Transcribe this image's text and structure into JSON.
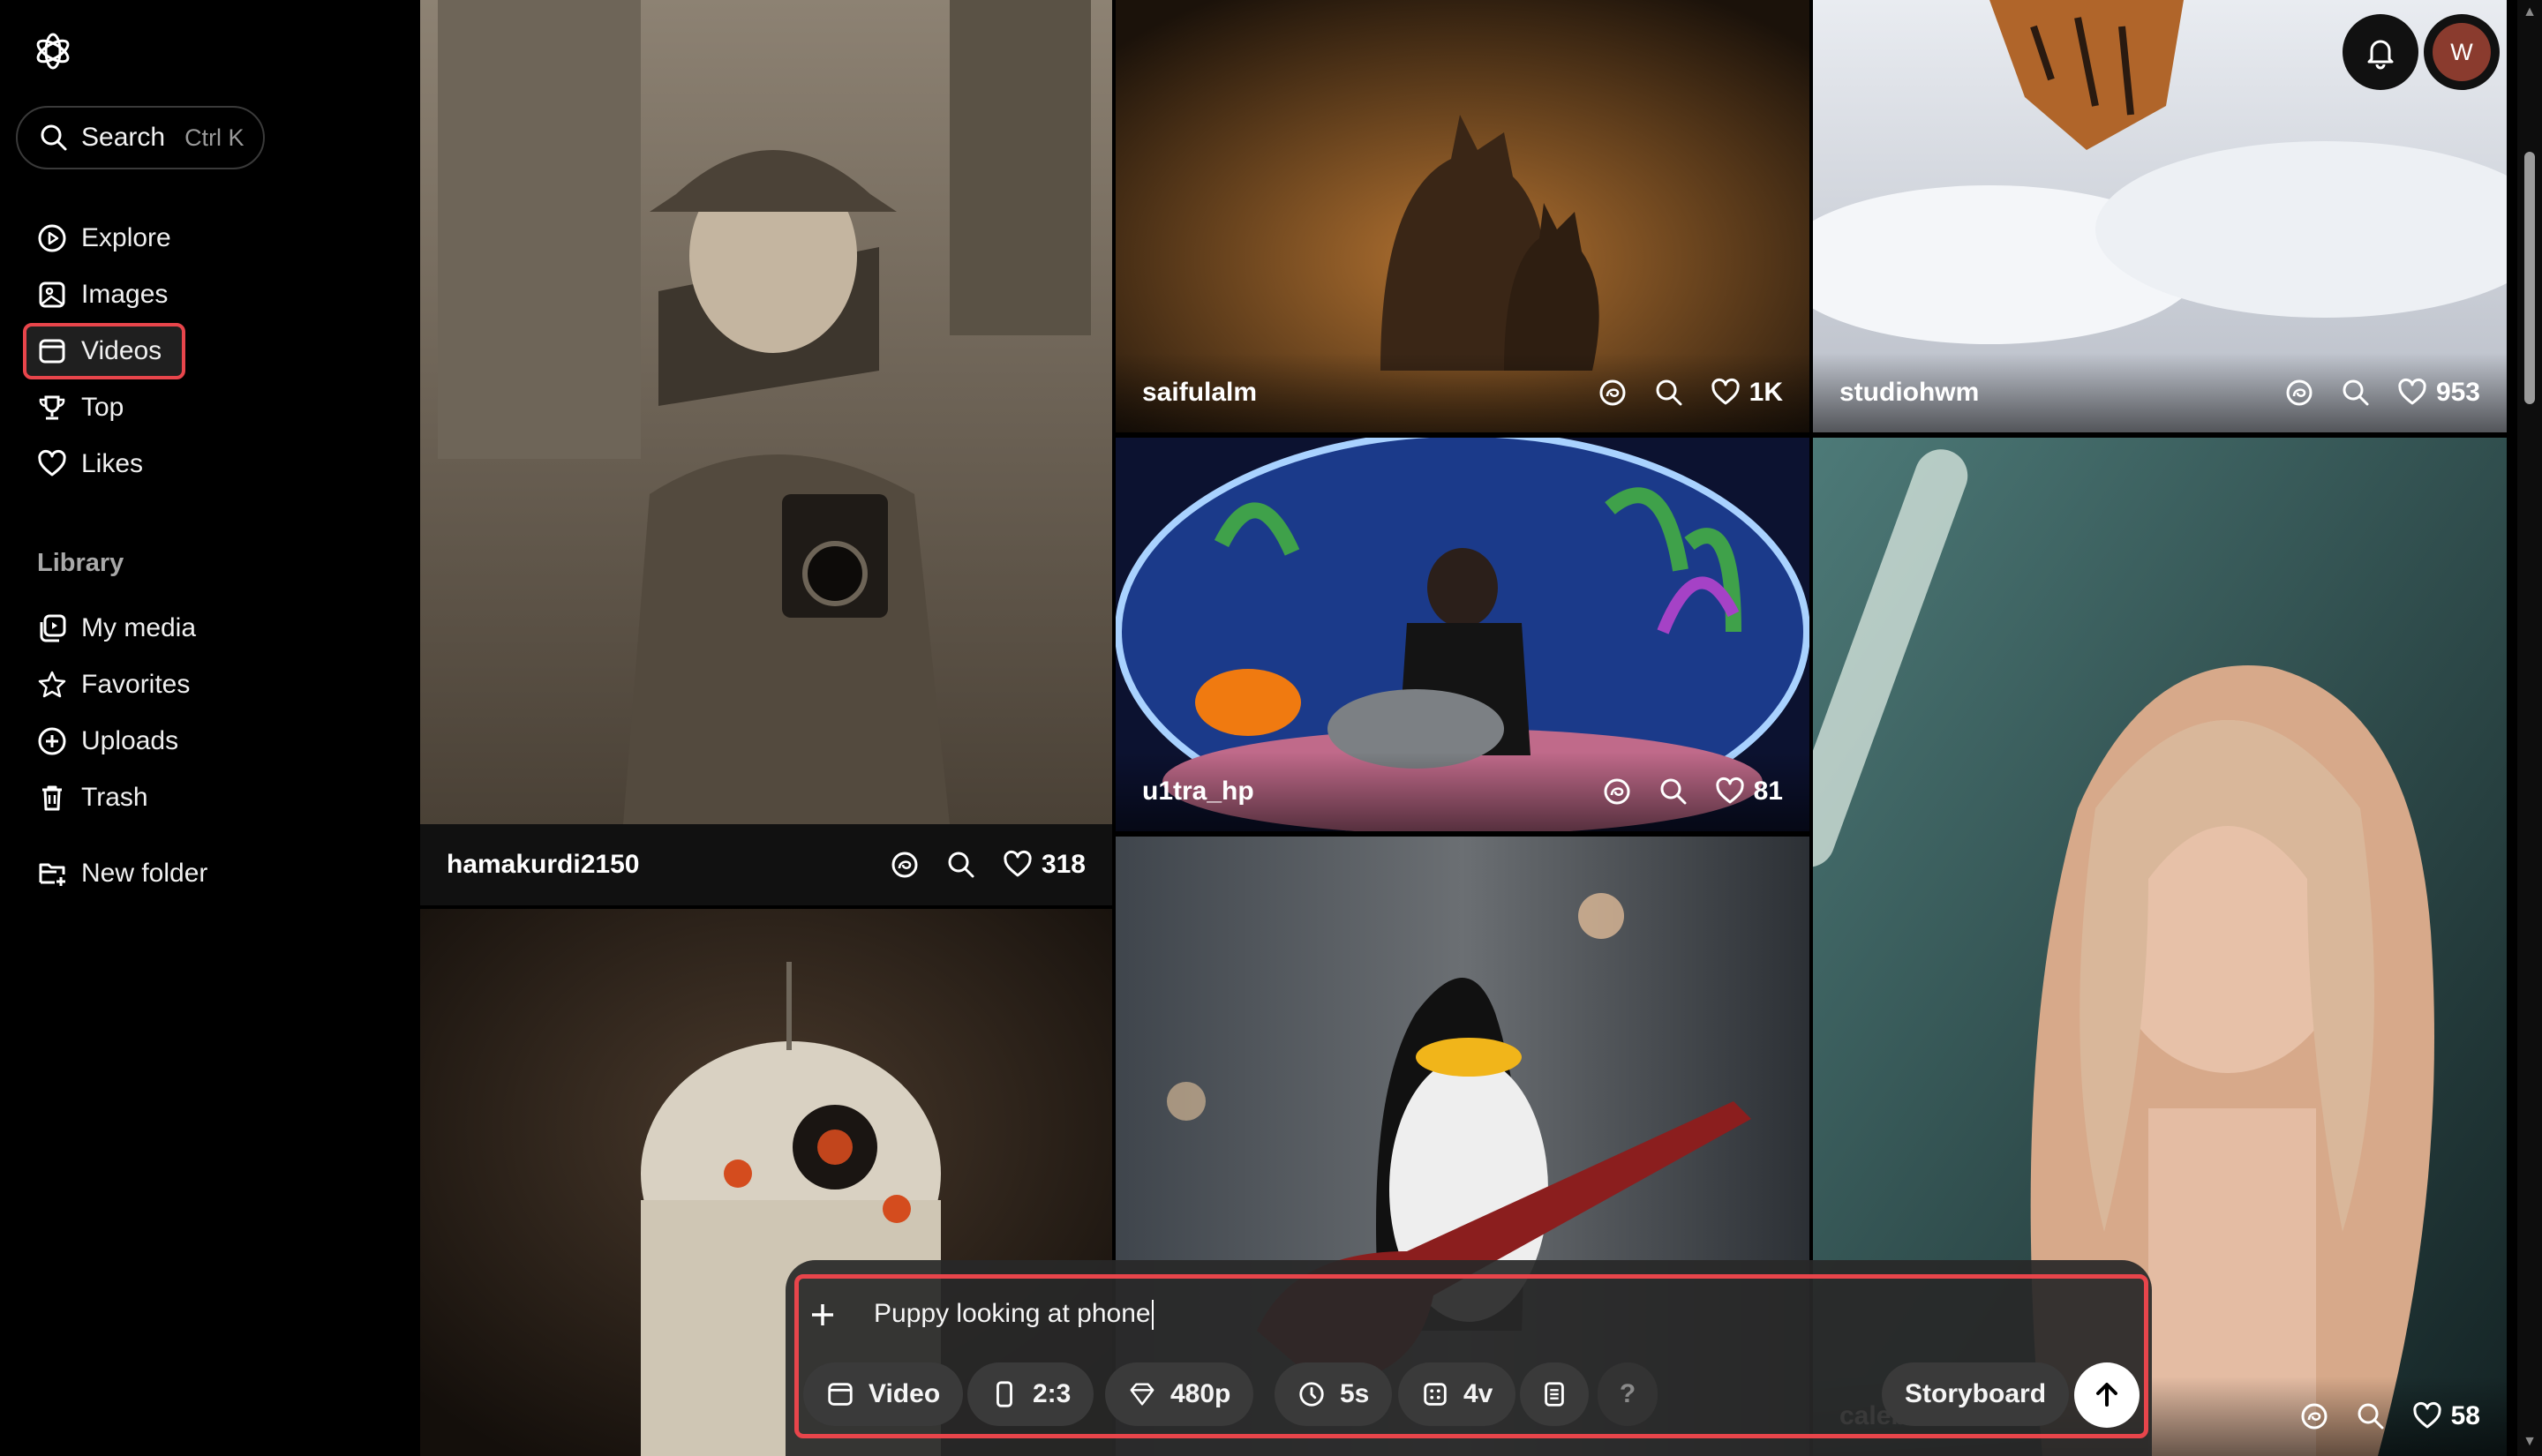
{
  "sidebar": {
    "search": {
      "label": "Search",
      "shortcut": "Ctrl K"
    },
    "nav": [
      {
        "label": "Explore",
        "icon": "play-circle-icon"
      },
      {
        "label": "Images",
        "icon": "image-icon"
      },
      {
        "label": "Videos",
        "icon": "video-icon"
      },
      {
        "label": "Top",
        "icon": "trophy-icon"
      },
      {
        "label": "Likes",
        "icon": "heart-icon"
      }
    ],
    "library_title": "Library",
    "library": [
      {
        "label": "My media",
        "icon": "media-icon"
      },
      {
        "label": "Favorites",
        "icon": "star-icon"
      },
      {
        "label": "Uploads",
        "icon": "upload-icon"
      },
      {
        "label": "Trash",
        "icon": "trash-icon"
      }
    ],
    "new_folder": "New folder"
  },
  "header": {
    "avatar_initial": "W"
  },
  "feed": [
    {
      "user": "hamakurdi2150",
      "likes": "318",
      "subject": "vintage man with camera"
    },
    {
      "user": "saifulalm",
      "likes": "1K",
      "subject": "two cats in alley"
    },
    {
      "user": "studiohwm",
      "likes": "953",
      "subject": "tiger in snow"
    },
    {
      "user": "u1tra_hp",
      "likes": "81",
      "subject": "chimp in fishbowl"
    },
    {
      "user": "",
      "likes": "",
      "subject": "robot droid"
    },
    {
      "user": "",
      "likes": "",
      "subject": "penguin with guitar"
    },
    {
      "user": "calebisheer",
      "likes": "58",
      "subject": "woman portrait"
    }
  ],
  "composer": {
    "prompt": "Puppy looking at phone",
    "type": "Video",
    "aspect": "2:3",
    "resolution": "480p",
    "duration": "5s",
    "variations": "4v",
    "help": "?",
    "storyboard": "Storyboard"
  },
  "colors": {
    "highlight": "#e8454b",
    "background": "#000000"
  }
}
